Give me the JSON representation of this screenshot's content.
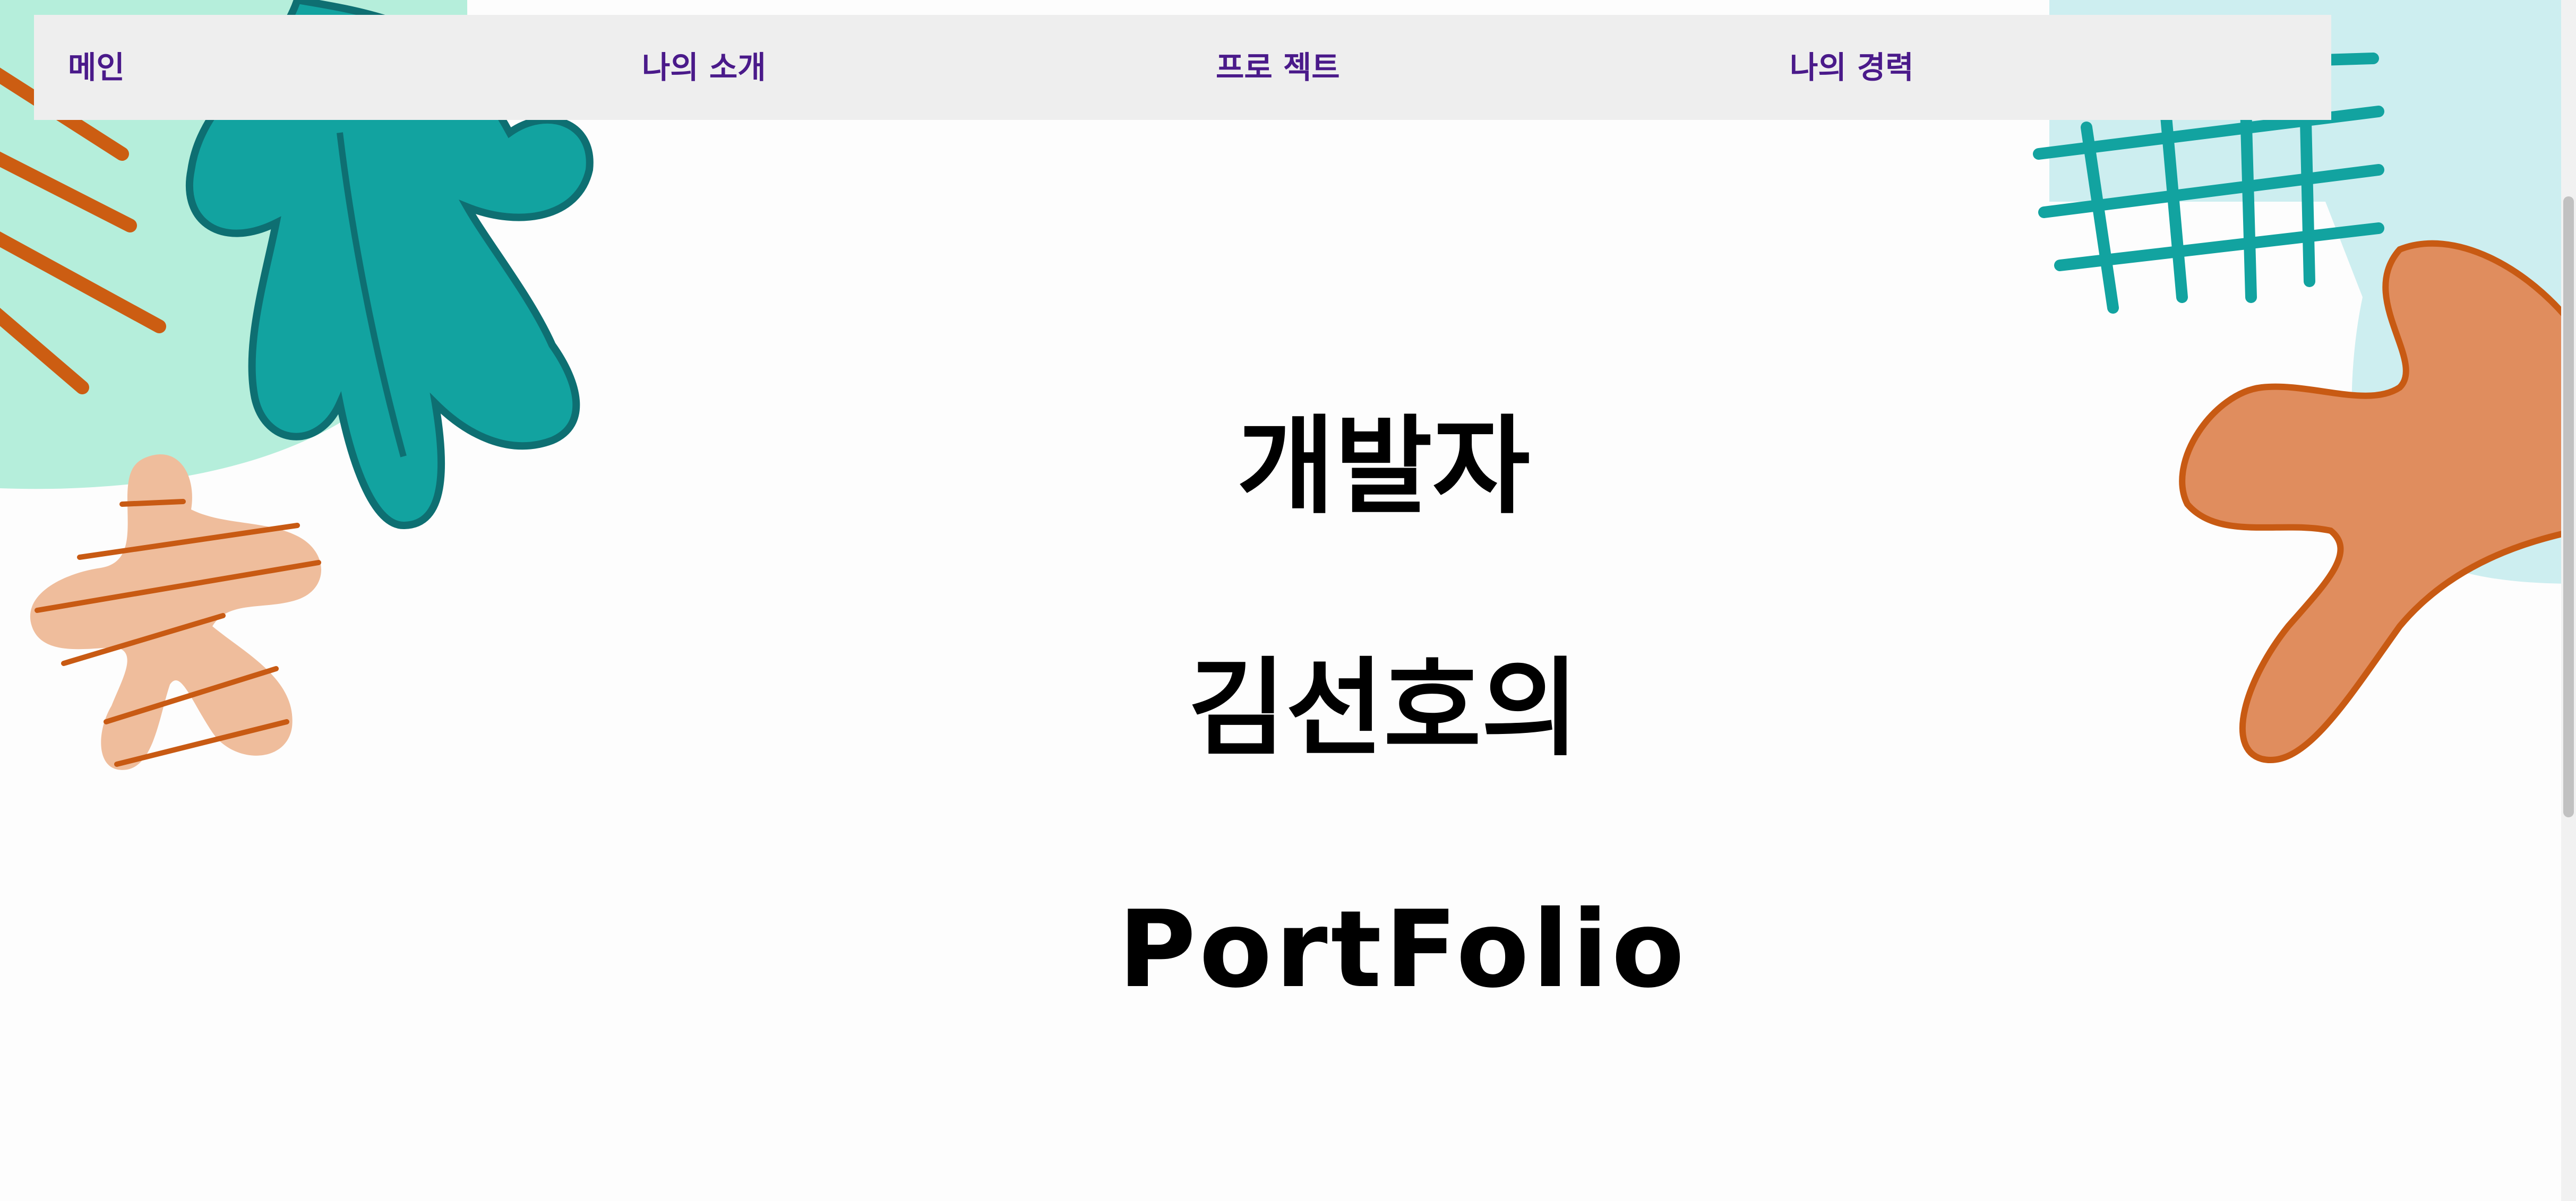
{
  "nav": {
    "items": [
      {
        "label": "메인"
      },
      {
        "label": "나의 소개"
      },
      {
        "label": "프로 젝트"
      },
      {
        "label": "나의 경력"
      }
    ]
  },
  "hero": {
    "line1": "개발자",
    "line2": "김선호의",
    "line3": "PortFolio"
  },
  "colors": {
    "nav_text": "#4a1a8a",
    "mint": "#b5eedb",
    "teal": "#12a3a0",
    "orange": "#d66a1e",
    "peach": "#efbd9c",
    "light_blue": "#cdeef0",
    "orange_blob": "#e08d5e"
  },
  "icons": {
    "decor_left": "leaf-blob-shapes",
    "decor_right": "grid-and-blob-shapes"
  }
}
